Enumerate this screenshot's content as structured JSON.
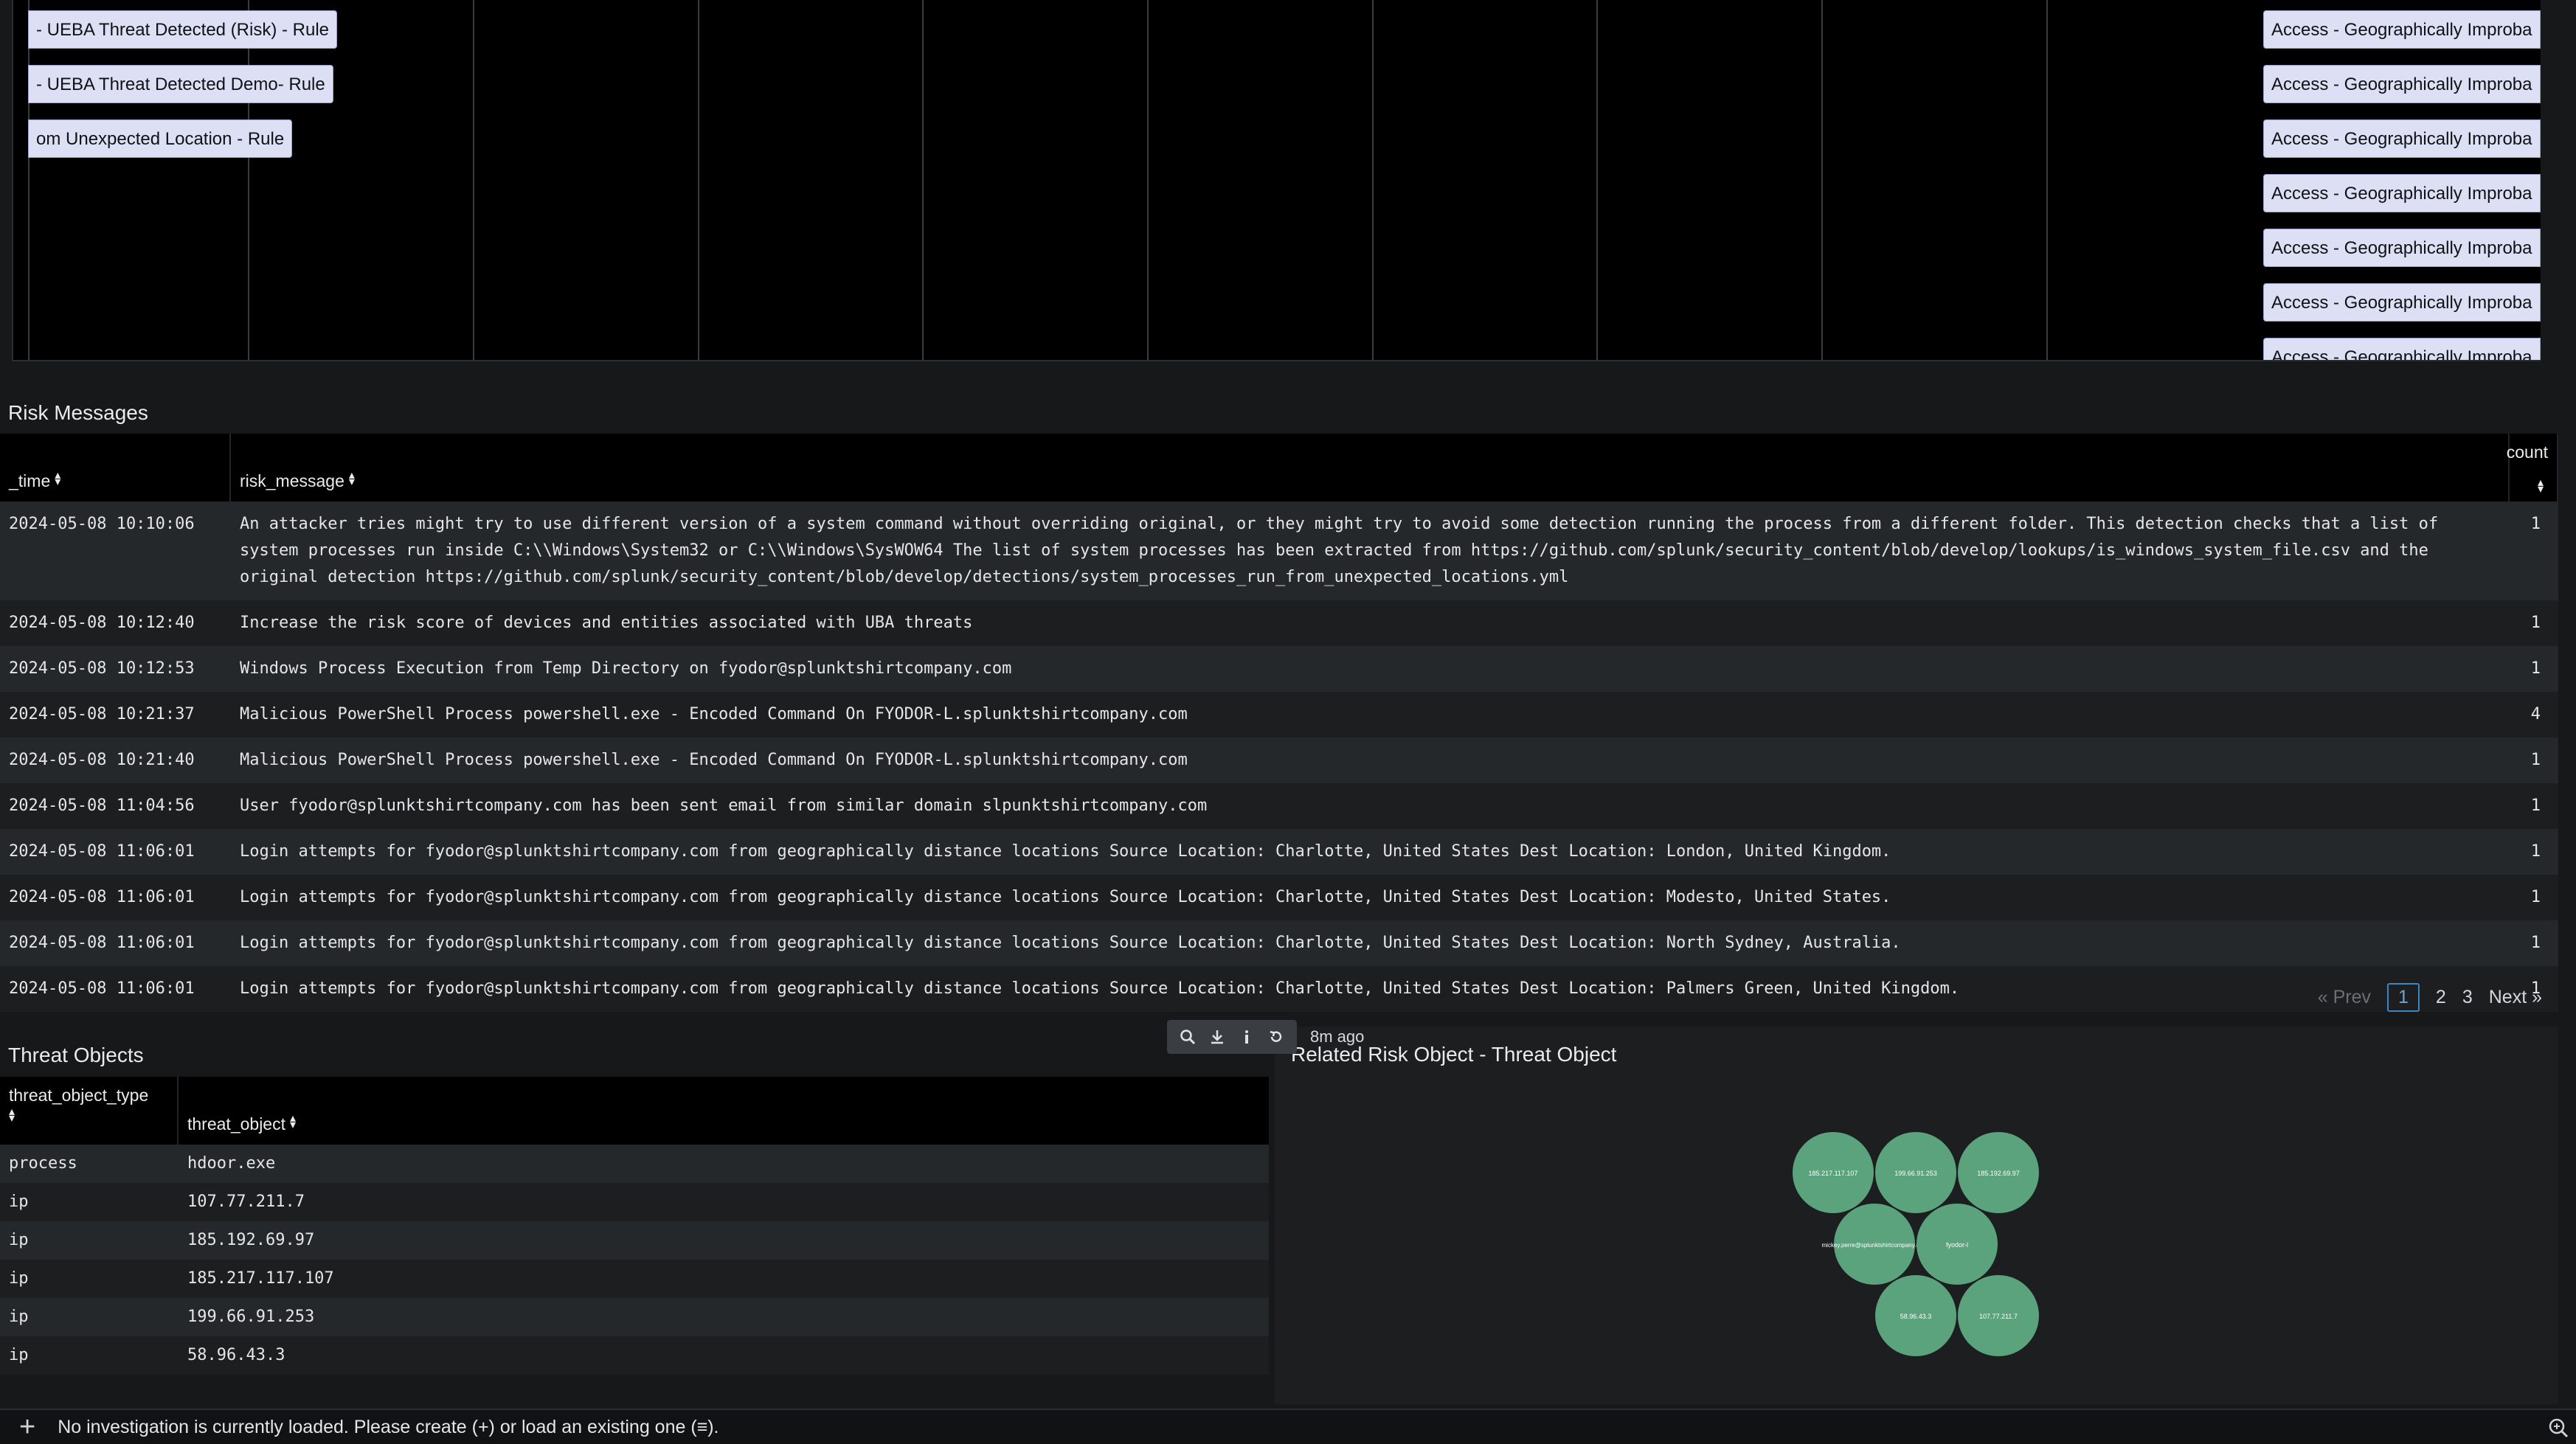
{
  "timeline": {
    "left_bars": [
      "- UEBA Threat Detected (Risk) - Rule",
      "- UEBA Threat Detected Demo- Rule",
      "om Unexpected Location - Rule"
    ],
    "right_bars": [
      "Access - Geographically Improba",
      "Access - Geographically Improba",
      "Access - Geographically Improba",
      "Access - Geographically Improba",
      "Access - Geographically Improba",
      "Access - Geographically Improba",
      "Access - Geographically Improba"
    ]
  },
  "risk_messages": {
    "title": "Risk Messages",
    "columns": {
      "time": "_time",
      "message": "risk_message",
      "count": "count"
    },
    "rows": [
      {
        "time": "2024-05-08 10:10:06",
        "message": "An attacker tries might try to use different version of a system command without overriding original, or they might try to avoid some detection running the process from a different folder. This detection checks that a list of system processes run inside C:\\\\Windows\\System32 or C:\\\\Windows\\SysWOW64 The list of system processes has been extracted from https://github.com/splunk/security_content/blob/develop/lookups/is_windows_system_file.csv and the original detection https://github.com/splunk/security_content/blob/develop/detections/system_processes_run_from_unexpected_locations.yml",
        "count": "1"
      },
      {
        "time": "2024-05-08 10:12:40",
        "message": "Increase the risk score of devices and entities associated with UBA threats",
        "count": "1"
      },
      {
        "time": "2024-05-08 10:12:53",
        "message": "Windows Process Execution from Temp Directory on fyodor@splunktshirtcompany.com",
        "count": "1"
      },
      {
        "time": "2024-05-08 10:21:37",
        "message": "Malicious PowerShell Process powershell.exe - Encoded Command On FYODOR-L.splunktshirtcompany.com",
        "count": "4"
      },
      {
        "time": "2024-05-08 10:21:40",
        "message": "Malicious PowerShell Process powershell.exe - Encoded Command On FYODOR-L.splunktshirtcompany.com",
        "count": "1"
      },
      {
        "time": "2024-05-08 11:04:56",
        "message": "User fyodor@splunktshirtcompany.com has been sent email from similar domain slpunktshirtcompany.com",
        "count": "1"
      },
      {
        "time": "2024-05-08 11:06:01",
        "message": "Login attempts for fyodor@splunktshirtcompany.com from geographically distance locations Source Location: Charlotte, United States Dest Location: London, United Kingdom.",
        "count": "1"
      },
      {
        "time": "2024-05-08 11:06:01",
        "message": "Login attempts for fyodor@splunktshirtcompany.com from geographically distance locations Source Location: Charlotte, United States Dest Location: Modesto, United States.",
        "count": "1"
      },
      {
        "time": "2024-05-08 11:06:01",
        "message": "Login attempts for fyodor@splunktshirtcompany.com from geographically distance locations Source Location: Charlotte, United States Dest Location: North Sydney, Australia.",
        "count": "1"
      },
      {
        "time": "2024-05-08 11:06:01",
        "message": "Login attempts for fyodor@splunktshirtcompany.com from geographically distance locations Source Location: Charlotte, United States Dest Location: Palmers Green, United Kingdom.",
        "count": "1"
      }
    ],
    "pager": {
      "prev": "« Prev",
      "pages": [
        "1",
        "2",
        "3"
      ],
      "current": "1",
      "next": "Next »"
    }
  },
  "threat_objects": {
    "title": "Threat Objects",
    "columns": {
      "type": "threat_object_type",
      "object": "threat_object"
    },
    "rows": [
      {
        "type": "process",
        "object": "hdoor.exe"
      },
      {
        "type": "ip",
        "object": "107.77.211.7"
      },
      {
        "type": "ip",
        "object": "185.192.69.97"
      },
      {
        "type": "ip",
        "object": "185.217.117.107"
      },
      {
        "type": "ip",
        "object": "199.66.91.253"
      },
      {
        "type": "ip",
        "object": "58.96.43.3"
      }
    ]
  },
  "graph": {
    "title": "Related Risk Object - Threat Object",
    "node_color": "#5aa37c",
    "nodes": [
      "185.217.117.107",
      "199.66.91.253",
      "185.192.69.97",
      "mickey.perre@splunktshirtcompany.com",
      "fyodor-l",
      "58.96.43.3",
      "107.77.211.7"
    ],
    "toolbar_icons": [
      "search-icon",
      "download-icon",
      "info-icon",
      "refresh-icon"
    ],
    "last_refresh": "8m ago"
  },
  "footer": {
    "add_glyph": "+",
    "message": "No investigation is currently loaded. Please create (+) or load an existing one (≡)."
  }
}
